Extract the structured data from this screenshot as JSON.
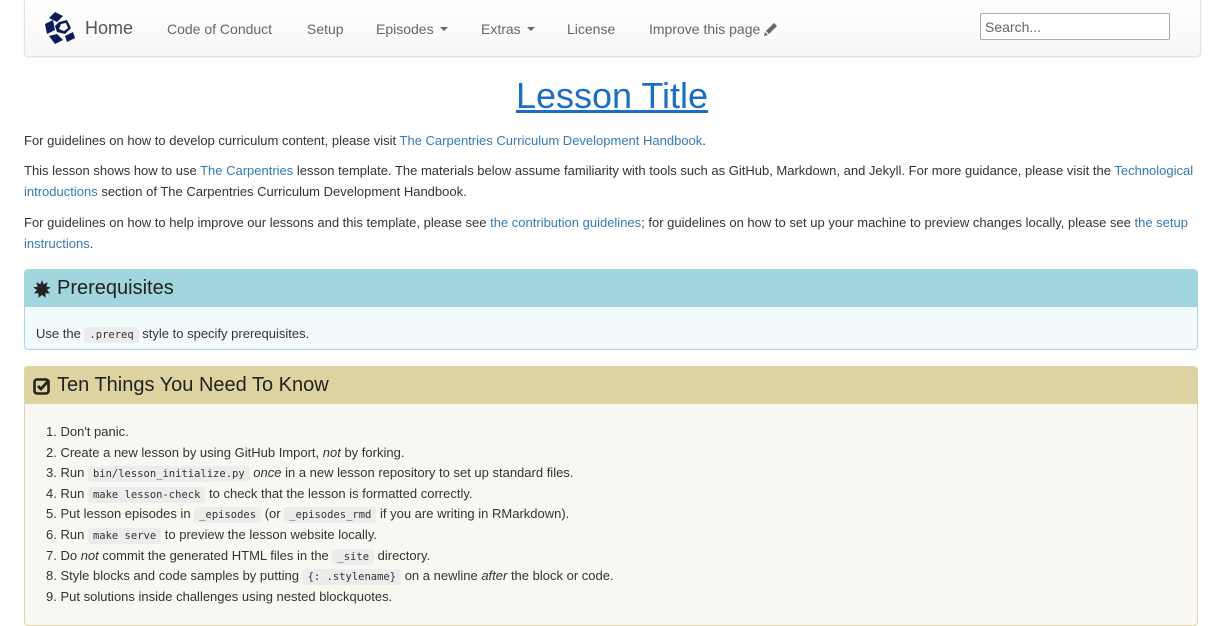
{
  "navbar": {
    "brand_label": "Home",
    "items": [
      {
        "label": "Code of Conduct"
      },
      {
        "label": "Setup"
      },
      {
        "label": "Episodes",
        "dropdown": true
      },
      {
        "label": "Extras",
        "dropdown": true
      },
      {
        "label": "License"
      },
      {
        "label": "Improve this page",
        "icon": "pencil-icon"
      }
    ],
    "search_placeholder": "Search...",
    "search_value": ""
  },
  "page": {
    "title": "Lesson Title",
    "paragraphs": [
      {
        "before": "For guidelines on how to develop curriculum content, please visit ",
        "link": "The Carpentries Curriculum Development Handbook",
        "after": "."
      },
      {
        "before": "This lesson shows how to use ",
        "link1": "The Carpentries",
        "middle": " lesson template. The materials below assume familiarity with tools such as GitHub, Markdown, and Jekyll. For more guidance, please visit the ",
        "link2": "Technological introductions",
        "after": " section of The Carpentries Curriculum Development Handbook."
      },
      {
        "before": "For guidelines on how to help improve our lessons and this template, please see ",
        "link1": "the contribution guidelines",
        "middle": "; for guidelines on how to set up your machine to preview changes locally, please see ",
        "link2": "the setup instructions",
        "after": "."
      }
    ]
  },
  "prereq": {
    "title": "Prerequisites",
    "icon": "asterisk-icon",
    "text_before": "Use the ",
    "code": ".prereq",
    "text_after": " style to specify prerequisites."
  },
  "know": {
    "title": "Ten Things You Need To Know",
    "icon": "check-square-icon",
    "items": [
      {
        "n": "1.",
        "a": "Don't panic."
      },
      {
        "n": "2.",
        "a": "Create a new lesson by using GitHub Import, ",
        "em": "not",
        "b": " by forking."
      },
      {
        "n": "3.",
        "a": "Run ",
        "code": "bin/lesson_initialize.py",
        "em": "once",
        "b": " in a new lesson repository to set up standard files."
      },
      {
        "n": "4.",
        "a": "Run ",
        "code": "make lesson-check",
        "b": " to check that the lesson is formatted correctly."
      },
      {
        "n": "5.",
        "a": "Put lesson episodes in ",
        "code": "_episodes",
        "mid": " (or ",
        "code2": "_episodes_rmd",
        "b": " if you are writing in RMarkdown)."
      },
      {
        "n": "6.",
        "a": "Run ",
        "code": "make serve",
        "b": " to preview the lesson website locally."
      },
      {
        "n": "7.",
        "a": "Do ",
        "em": "not",
        "mid": " commit the generated HTML files in the ",
        "code": "_site",
        "b": " directory."
      },
      {
        "n": "8.",
        "a": "Style blocks and code samples by putting ",
        "code": "{: .stylename}",
        "mid": " on a newline ",
        "em": "after",
        "b": " the block or code."
      },
      {
        "n": "9.",
        "a": "Put solutions inside challenges using nested blockquotes."
      }
    ]
  },
  "colors": {
    "link": "#337ab7",
    "title_link": "#1a6fc4",
    "prereq_header": "#a1d6df",
    "prereq_body": "#f2fafc",
    "know_header": "#ddd3a1",
    "know_body": "#f9f7f2",
    "brand_logo": "#0b1a5c"
  }
}
